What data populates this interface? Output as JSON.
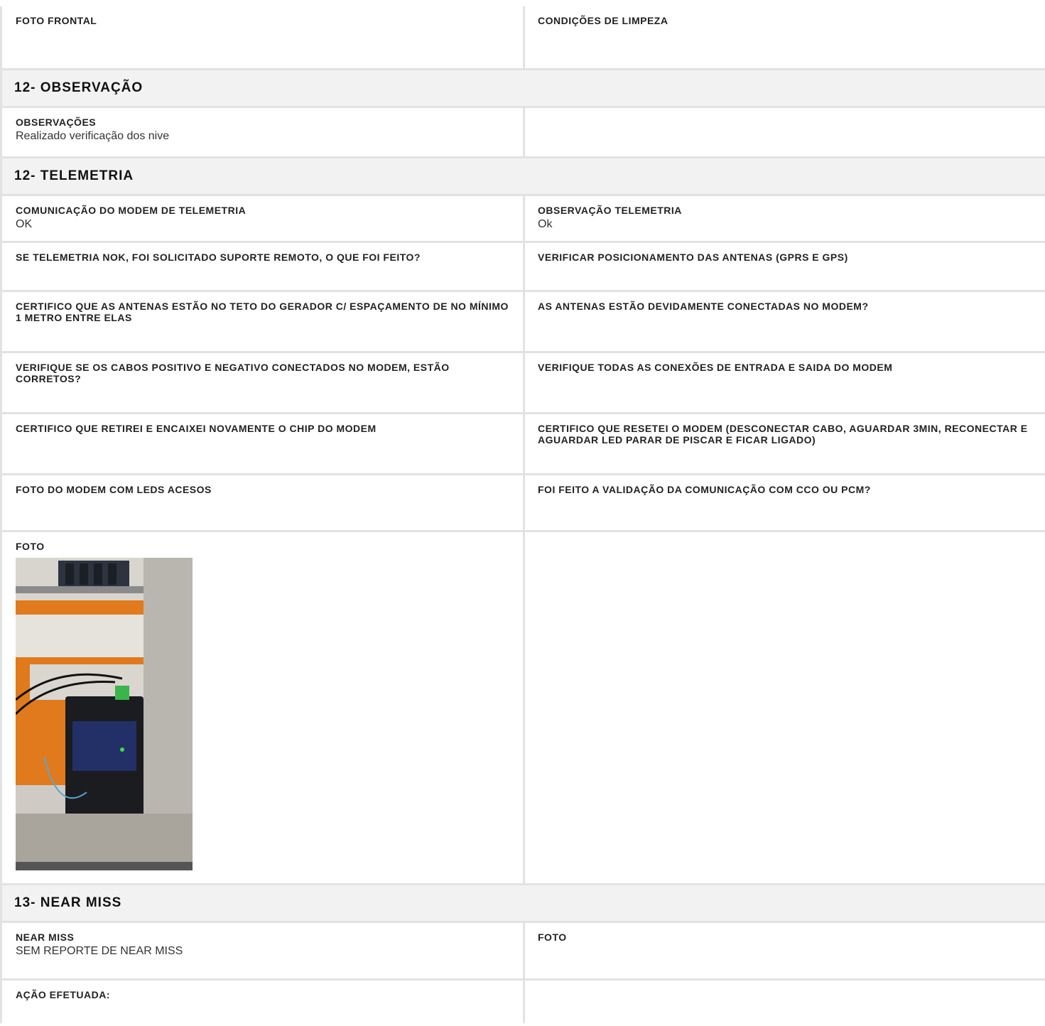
{
  "rows_top": [
    {
      "left": {
        "label": "FOTO FRONTAL",
        "value": ""
      },
      "right": {
        "label": "CONDIÇÕES DE LIMPEZA",
        "value": ""
      }
    }
  ],
  "sections": {
    "observacao": {
      "title": "12- OBSERVAÇÃO",
      "observacoes_label": "OBSERVAÇÕES",
      "observacoes_value": "Realizado verificação dos nive"
    },
    "telemetria": {
      "title": "12- TELEMETRIA",
      "rows": [
        {
          "left": {
            "label": "COMUNICAÇÃO DO MODEM DE TELEMETRIA",
            "value": "OK"
          },
          "right": {
            "label": "OBSERVAÇÃO TELEMETRIA",
            "value": "Ok"
          }
        },
        {
          "left": {
            "label": "SE TELEMETRIA NOK, FOI SOLICITADO SUPORTE REMOTO, O QUE FOI FEITO?",
            "value": ""
          },
          "right": {
            "label": "VERIFICAR POSICIONAMENTO DAS ANTENAS (GPRS E GPS)",
            "value": ""
          }
        },
        {
          "left": {
            "label": "CERTIFICO QUE AS ANTENAS ESTÃO NO TETO DO GERADOR C/ ESPAÇAMENTO DE NO MÍNIMO 1 METRO ENTRE ELAS",
            "value": ""
          },
          "right": {
            "label": "AS ANTENAS ESTÃO DEVIDAMENTE CONECTADAS NO MODEM?",
            "value": ""
          }
        },
        {
          "left": {
            "label": "VERIFIQUE SE OS CABOS POSITIVO E NEGATIVO CONECTADOS NO MODEM, ESTÃO CORRETOS?",
            "value": ""
          },
          "right": {
            "label": "VERIFIQUE TODAS AS CONEXÕES DE ENTRADA E SAIDA DO MODEM",
            "value": ""
          }
        },
        {
          "left": {
            "label": "CERTIFICO QUE RETIREI E ENCAIXEI NOVAMENTE O CHIP DO MODEM",
            "value": ""
          },
          "right": {
            "label": "CERTIFICO QUE RESETEI O MODEM (DESCONECTAR CABO, AGUARDAR 3MIN, RECONECTAR E AGUARDAR LED PARAR DE PISCAR E FICAR LIGADO)",
            "value": ""
          }
        },
        {
          "left": {
            "label": "FOTO DO MODEM COM LEDS ACESOS",
            "value": ""
          },
          "right": {
            "label": "FOI FEITO A VALIDAÇÃO DA COMUNICAÇÃO COM CCO OU PCM?",
            "value": ""
          }
        }
      ],
      "foto_label": "FOTO"
    },
    "near_miss": {
      "title": "13- NEAR MISS",
      "near_miss_label": "NEAR MISS",
      "near_miss_value": "SEM REPORTE DE NEAR MISS",
      "foto_label": "FOTO",
      "acao_label": "AÇÃO EFETUADA:"
    }
  },
  "colors": {
    "border": "#e2e2e2",
    "section_bg": "#f2f2f2"
  }
}
